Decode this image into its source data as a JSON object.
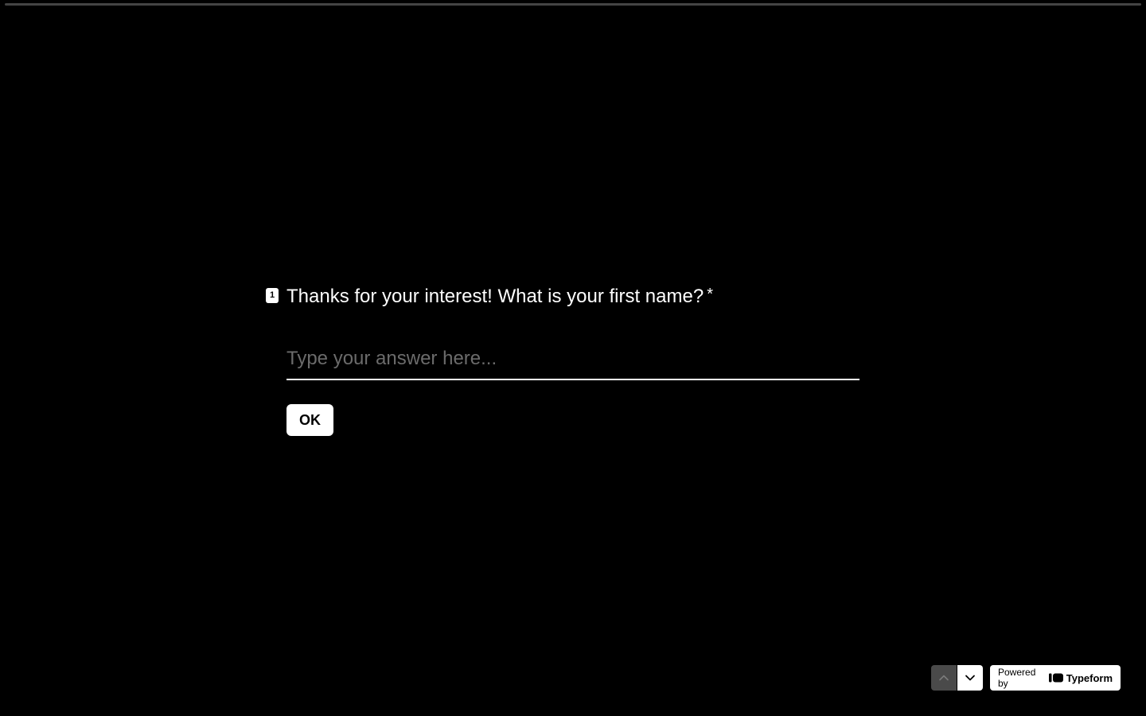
{
  "progress": {
    "fraction": 0
  },
  "question": {
    "number": "1",
    "text": "Thanks for your interest! What is your first name?",
    "required_mark": "*"
  },
  "answer": {
    "placeholder": "Type your answer here...",
    "value": ""
  },
  "ok_button": {
    "label": "OK"
  },
  "navigation": {
    "up_icon": "chevron-up-icon",
    "down_icon": "chevron-down-icon"
  },
  "branding": {
    "powered_by": "Powered by",
    "brand_name": "Typeform",
    "logo_icon": "typeform-logo-icon"
  },
  "colors": {
    "background": "#000000",
    "text": "#ffffff",
    "placeholder": "#6b6b6b",
    "nav_disabled": "#4a4a4a"
  }
}
